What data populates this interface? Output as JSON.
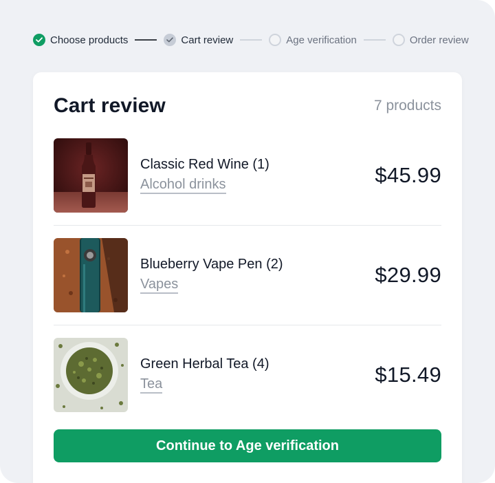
{
  "stepper": {
    "steps": [
      {
        "label": "Choose products",
        "state": "done"
      },
      {
        "label": "Cart review",
        "state": "current"
      },
      {
        "label": "Age verification",
        "state": "todo"
      },
      {
        "label": "Order review",
        "state": "todo"
      }
    ]
  },
  "cart": {
    "title": "Cart review",
    "count": "7 products",
    "items": [
      {
        "name": "Classic Red Wine (1)",
        "category": "Alcohol drinks",
        "price": "$45.99"
      },
      {
        "name": "Blueberry Vape Pen (2)",
        "category": "Vapes",
        "price": "$29.99"
      },
      {
        "name": "Green Herbal Tea (4)",
        "category": "Tea",
        "price": "$15.49"
      }
    ],
    "cta_label": "Continue to Age verification"
  },
  "colors": {
    "accent": "#0f9d63",
    "background": "#eff1f5",
    "muted_text": "#8b929c"
  }
}
